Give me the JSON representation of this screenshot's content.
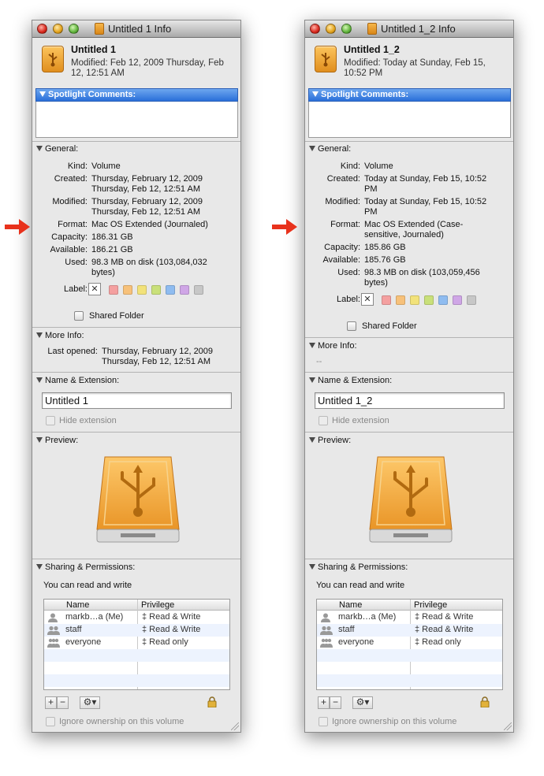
{
  "windows": [
    {
      "title": "Untitled 1 Info",
      "name": "Untitled 1",
      "modified_header": "Modified: Feb 12, 2009 Thursday, Feb\n12, 12:51 AM",
      "spotlight_label": "Spotlight Comments:",
      "general": {
        "heading": "General:",
        "rows": [
          {
            "k": "Kind:",
            "v": "Volume"
          },
          {
            "k": "Created:",
            "v": "Thursday, February 12, 2009\nThursday, Feb 12, 12:51 AM"
          },
          {
            "k": "Modified:",
            "v": "Thursday, February 12, 2009\nThursday, Feb 12, 12:51 AM"
          },
          {
            "k": "Format:",
            "v": "Mac OS Extended (Journaled)"
          },
          {
            "k": "Capacity:",
            "v": "186.31 GB"
          },
          {
            "k": "Available:",
            "v": "186.21 GB"
          },
          {
            "k": "Used:",
            "v": "98.3 MB on disk (103,084,032\nbytes)"
          }
        ],
        "label_k": "Label:",
        "shared": "Shared Folder"
      },
      "more": {
        "heading": "More Info:",
        "k": "Last opened:",
        "v": "Thursday, February 12, 2009\nThursday, Feb 12, 12:51 AM"
      },
      "nameext": {
        "heading": "Name & Extension:",
        "value": "Untitled 1",
        "hide": "Hide extension"
      },
      "preview": {
        "heading": "Preview:"
      },
      "sharing": {
        "heading": "Sharing & Permissions:",
        "status": "You can read and write",
        "col_name": "Name",
        "col_priv": "Privilege",
        "rows": [
          {
            "name": "markb…a (Me)",
            "priv": "‡ Read & Write"
          },
          {
            "name": "staff",
            "priv": "‡ Read & Write"
          },
          {
            "name": "everyone",
            "priv": "‡ Read only"
          }
        ],
        "ignore": "Ignore ownership on this volume"
      }
    },
    {
      "title": "Untitled 1_2 Info",
      "name": "Untitled 1_2",
      "modified_header": "Modified: Today at Sunday, Feb 15,\n10:52 PM",
      "spotlight_label": "Spotlight Comments:",
      "general": {
        "heading": "General:",
        "rows": [
          {
            "k": "Kind:",
            "v": "Volume"
          },
          {
            "k": "Created:",
            "v": "Today at Sunday, Feb 15, 10:52\nPM"
          },
          {
            "k": "Modified:",
            "v": "Today at Sunday, Feb 15, 10:52\nPM"
          },
          {
            "k": "Format:",
            "v": "Mac OS Extended (Case-\nsensitive, Journaled)"
          },
          {
            "k": "Capacity:",
            "v": "185.86 GB"
          },
          {
            "k": "Available:",
            "v": "185.76 GB"
          },
          {
            "k": "Used:",
            "v": "98.3 MB on disk (103,059,456\nbytes)"
          }
        ],
        "label_k": "Label:",
        "shared": "Shared Folder"
      },
      "more": {
        "heading": "More Info:",
        "v": "--"
      },
      "nameext": {
        "heading": "Name & Extension:",
        "value": "Untitled 1_2",
        "hide": "Hide extension"
      },
      "preview": {
        "heading": "Preview:"
      },
      "sharing": {
        "heading": "Sharing & Permissions:",
        "status": "You can read and write",
        "col_name": "Name",
        "col_priv": "Privilege",
        "rows": [
          {
            "name": "markb…a (Me)",
            "priv": "‡ Read & Write"
          },
          {
            "name": "staff",
            "priv": "‡ Read & Write"
          },
          {
            "name": "everyone",
            "priv": "‡ Read only"
          }
        ],
        "ignore": "Ignore ownership on this volume"
      }
    }
  ],
  "label_colors": [
    "#f4a0a0",
    "#f7c17a",
    "#f2e27a",
    "#c9e07a",
    "#8fbcf0",
    "#cfa6e6",
    "#c7c7c7"
  ],
  "annotation": {
    "arrow_color": "#e8321c",
    "arrow_icon": "red-arrow-icon"
  }
}
